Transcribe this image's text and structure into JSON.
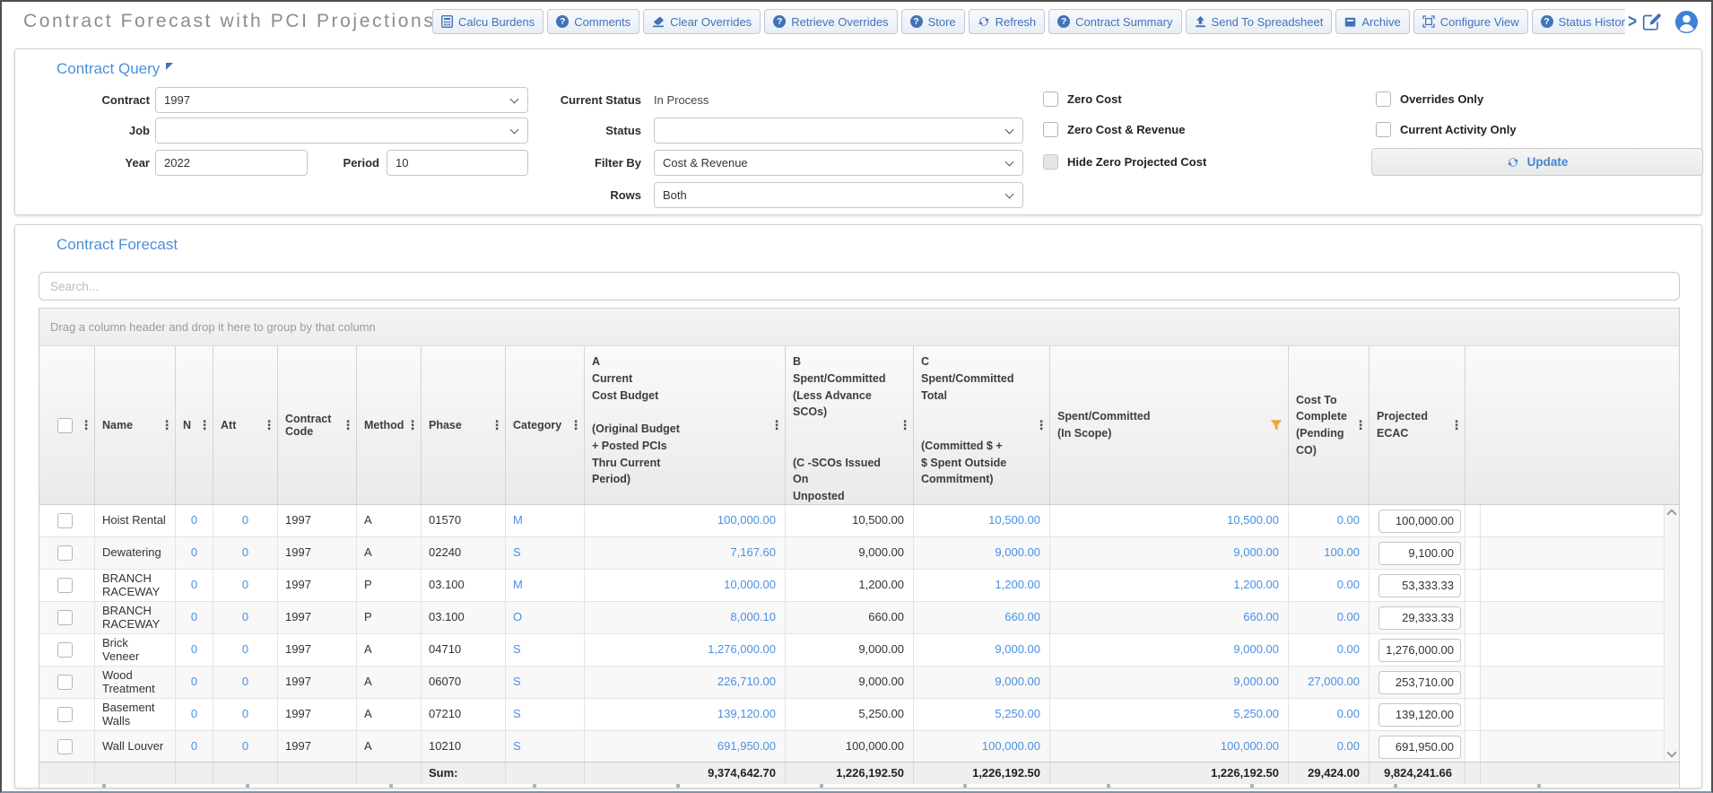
{
  "toolbar": {
    "title": "Contract Forecast with PCI Projections",
    "buttons": [
      {
        "label": "Calcu Burdens",
        "icon": "calculator-icon"
      },
      {
        "label": "Comments",
        "icon": "question-circle-icon"
      },
      {
        "label": "Clear Overrides",
        "icon": "eraser-icon"
      },
      {
        "label": "Retrieve Overrides",
        "icon": "question-circle-icon"
      },
      {
        "label": "Store",
        "icon": "question-circle-icon"
      },
      {
        "label": "Refresh",
        "icon": "refresh-icon"
      },
      {
        "label": "Contract Summary",
        "icon": "question-circle-icon"
      },
      {
        "label": "Send To Spreadsheet",
        "icon": "upload-icon"
      },
      {
        "label": "Archive",
        "icon": "archive-icon"
      },
      {
        "label": "Configure View",
        "icon": "configure-icon"
      },
      {
        "label": "Status Histor",
        "icon": "question-circle-icon",
        "truncated": true
      }
    ],
    "overflow_chevron": ">"
  },
  "query": {
    "heading": "Contract Query",
    "contract": {
      "label": "Contract",
      "value": "1997"
    },
    "job": {
      "label": "Job",
      "value": ""
    },
    "year": {
      "label": "Year",
      "value": "2022"
    },
    "period": {
      "label": "Period",
      "value": "10"
    },
    "current_status": {
      "label": "Current Status",
      "value": "In Process"
    },
    "status": {
      "label": "Status",
      "value": ""
    },
    "filter_by": {
      "label": "Filter By",
      "value": "Cost & Revenue"
    },
    "rows": {
      "label": "Rows",
      "value": "Both"
    },
    "checkboxes": [
      {
        "label": "Zero Cost",
        "checked": false,
        "disabled": false
      },
      {
        "label": "Zero Cost & Revenue",
        "checked": false,
        "disabled": false
      },
      {
        "label": "Hide Zero Projected Cost",
        "checked": false,
        "disabled": true
      },
      {
        "label": "Overrides Only",
        "checked": false,
        "disabled": false
      },
      {
        "label": "Current Activity Only",
        "checked": false,
        "disabled": false
      }
    ],
    "update_button": "Update"
  },
  "forecast": {
    "heading": "Contract Forecast",
    "search_placeholder": "Search...",
    "group_hint": "Drag a column header and drop it here to group by that column",
    "columns": [
      {
        "label": ""
      },
      {
        "label": "Name"
      },
      {
        "label": "N"
      },
      {
        "label": "Att"
      },
      {
        "label": "Contract Code"
      },
      {
        "label": "Method"
      },
      {
        "label": "Phase"
      },
      {
        "label": "Category"
      },
      {
        "label": "A\nCurrent\nCost Budget\n\n(Original Budget\n+ Posted PCIs\nThru Current\nPeriod)"
      },
      {
        "label": "B\nSpent/Committed\n(Less Advance\nSCOs)\n\n\n(C -SCOs Issued On\nUnposted PCI/OCO)"
      },
      {
        "label": "C\nSpent/Committed\nTotal\n\n\n(Committed $ +\n$ Spent Outside\nCommitment)"
      },
      {
        "label": "Spent/Committed\n(In Scope)",
        "filtered": true
      },
      {
        "label": "Cost To\nComplete\n(Pending\nCO)"
      },
      {
        "label": "Projected\nECAC"
      }
    ],
    "rows": [
      {
        "name": "Hoist Rental",
        "n": "0",
        "att": "0",
        "contract_code": "1997",
        "method": "A",
        "phase": "01570",
        "category": "M",
        "a": "100,000.00",
        "b": "10,500.00",
        "c": "10,500.00",
        "in_scope": "10,500.00",
        "cost_to_complete": "0.00",
        "projected_ecac": "100,000.00"
      },
      {
        "name": "Dewatering",
        "n": "0",
        "att": "0",
        "contract_code": "1997",
        "method": "A",
        "phase": "02240",
        "category": "S",
        "a": "7,167.60",
        "b": "9,000.00",
        "c": "9,000.00",
        "in_scope": "9,000.00",
        "cost_to_complete": "100.00",
        "projected_ecac": "9,100.00"
      },
      {
        "name": "BRANCH RACEWAY",
        "n": "0",
        "att": "0",
        "contract_code": "1997",
        "method": "P",
        "phase": "03.100",
        "category": "M",
        "a": "10,000.00",
        "b": "1,200.00",
        "c": "1,200.00",
        "in_scope": "1,200.00",
        "cost_to_complete": "0.00",
        "projected_ecac": "53,333.33"
      },
      {
        "name": "BRANCH RACEWAY",
        "n": "0",
        "att": "0",
        "contract_code": "1997",
        "method": "P",
        "phase": "03.100",
        "category": "O",
        "a": "8,000.10",
        "b": "660.00",
        "c": "660.00",
        "in_scope": "660.00",
        "cost_to_complete": "0.00",
        "projected_ecac": "29,333.33"
      },
      {
        "name": "Brick Veneer",
        "n": "0",
        "att": "0",
        "contract_code": "1997",
        "method": "A",
        "phase": "04710",
        "category": "S",
        "a": "1,276,000.00",
        "b": "9,000.00",
        "c": "9,000.00",
        "in_scope": "9,000.00",
        "cost_to_complete": "0.00",
        "projected_ecac": "1,276,000.00"
      },
      {
        "name": "Wood Treatment",
        "n": "0",
        "att": "0",
        "contract_code": "1997",
        "method": "A",
        "phase": "06070",
        "category": "S",
        "a": "226,710.00",
        "b": "9,000.00",
        "c": "9,000.00",
        "in_scope": "9,000.00",
        "cost_to_complete": "27,000.00",
        "projected_ecac": "253,710.00"
      },
      {
        "name": "Basement Walls",
        "n": "0",
        "att": "0",
        "contract_code": "1997",
        "method": "A",
        "phase": "07210",
        "category": "S",
        "a": "139,120.00",
        "b": "5,250.00",
        "c": "5,250.00",
        "in_scope": "5,250.00",
        "cost_to_complete": "0.00",
        "projected_ecac": "139,120.00"
      },
      {
        "name": "Wall Louver",
        "n": "0",
        "att": "0",
        "contract_code": "1997",
        "method": "A",
        "phase": "10210",
        "category": "S",
        "a": "691,950.00",
        "b": "100,000.00",
        "c": "100,000.00",
        "in_scope": "100,000.00",
        "cost_to_complete": "0.00",
        "projected_ecac": "691,950.00"
      }
    ],
    "sum": {
      "label": "Sum:",
      "a": "9,374,642.70",
      "b": "1,226,192.50",
      "c": "1,226,192.50",
      "in_scope": "1,226,192.50",
      "cost_to_complete": "29,424.00",
      "projected_ecac": "9,824,241.66"
    }
  },
  "colors": {
    "accent_blue": "#4272b8",
    "link_blue": "#4a90e2",
    "heading_blue": "#4a90d9",
    "filter_orange": "#F2A33C"
  }
}
